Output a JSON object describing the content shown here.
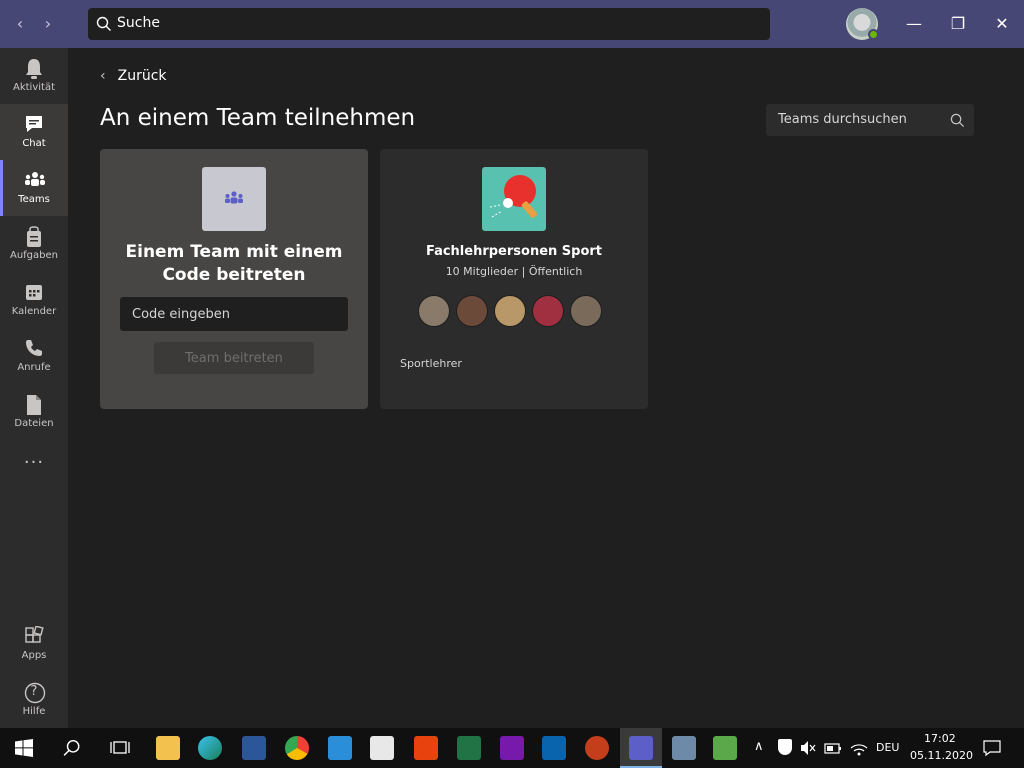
{
  "titlebar": {
    "search_label": "Suche",
    "back_arrow": "‹",
    "forward_arrow": "›",
    "minimize": "—",
    "maximize": "❐",
    "close": "✕"
  },
  "rail": {
    "items": [
      {
        "label": "Aktivität",
        "icon": "bell-icon"
      },
      {
        "label": "Chat",
        "icon": "chat-icon"
      },
      {
        "label": "Teams",
        "icon": "teams-icon"
      },
      {
        "label": "Aufgaben",
        "icon": "tasks-icon"
      },
      {
        "label": "Kalender",
        "icon": "calendar-icon"
      },
      {
        "label": "Anrufe",
        "icon": "phone-icon"
      },
      {
        "label": "Dateien",
        "icon": "file-icon"
      }
    ],
    "more": "···",
    "apps_label": "Apps",
    "help_label": "Hilfe",
    "help_glyph": "?"
  },
  "main": {
    "back_label": "Zurück",
    "back_chevron": "‹",
    "title": "An einem Team teilnehmen",
    "team_search_placeholder": "Teams durchsuchen"
  },
  "code_card": {
    "title": "Einem Team mit einem Code beitreten",
    "input_placeholder": "Code eingeben",
    "join_button": "Team beitreten"
  },
  "team_card": {
    "name": "Fachlehrpersonen Sport",
    "meta": "10 Mitglieder | Öffentlich",
    "description": "Sportlehrer",
    "member_colors": [
      "#8a7a6a",
      "#6b4a3a",
      "#b89868",
      "#a03040",
      "#7a6a5a"
    ]
  },
  "taskbar": {
    "language": "DEU",
    "time": "17:02",
    "date": "05.11.2020",
    "tray_up": "∧"
  },
  "colors": {
    "titlebar": "#464775",
    "accent": "#7f85f5",
    "rail": "#2d2c2c",
    "background": "#1f1f1f"
  }
}
